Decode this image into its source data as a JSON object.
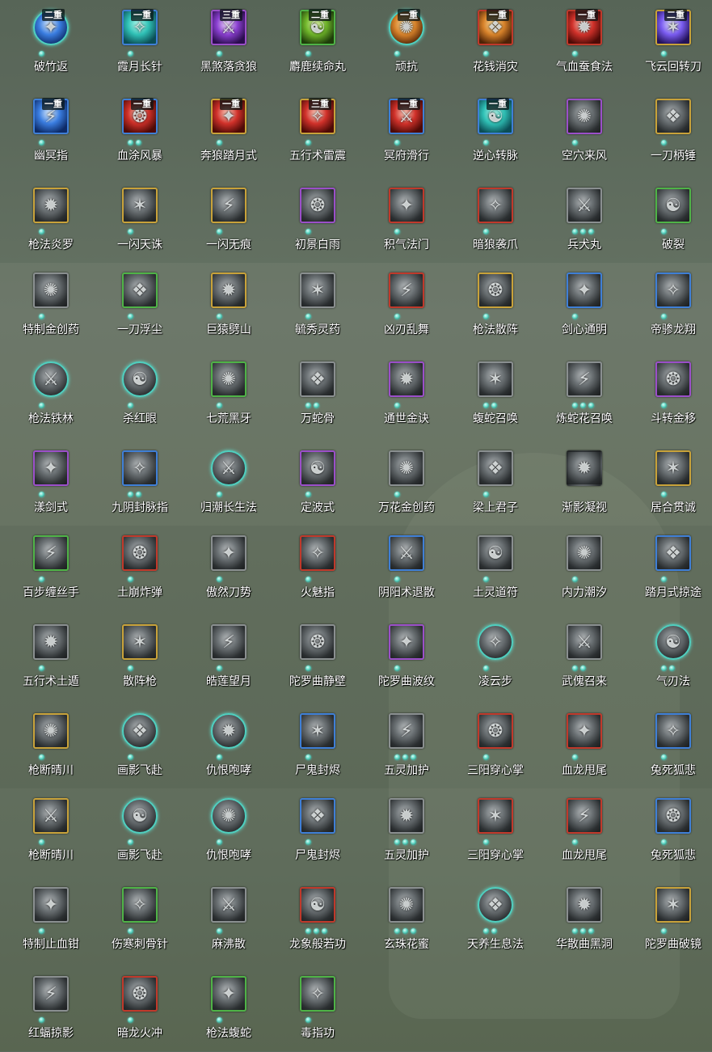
{
  "skills": [
    {
      "name": "破竹返",
      "badge": "二重",
      "dots": 1,
      "style": "circle",
      "color": "color-blue",
      "icon": "lightning-orb-icon"
    },
    {
      "name": "霞月长针",
      "badge": "一重",
      "dots": 1,
      "style": "cyan",
      "color": "color-cyan",
      "icon": "needle-icon"
    },
    {
      "name": "黑煞落贪狼",
      "badge": "三重",
      "dots": 1,
      "style": "purple",
      "color": "color-purple",
      "icon": "wolf-strike-icon"
    },
    {
      "name": "麝鹿续命丸",
      "badge": "二重",
      "dots": 1,
      "style": "green",
      "color": "color-green",
      "icon": "pill-icon"
    },
    {
      "name": "顽抗",
      "badge": "一重",
      "dots": 1,
      "style": "circle",
      "color": "color-orange",
      "icon": "flame-orb-icon"
    },
    {
      "name": "花钱消灾",
      "badge": "一重",
      "dots": 1,
      "style": "red",
      "color": "color-orange",
      "icon": "money-bag-icon"
    },
    {
      "name": "气血蚕食法",
      "badge": "一重",
      "dots": 1,
      "style": "red",
      "color": "color-red",
      "icon": "blood-burst-icon"
    },
    {
      "name": "飞云回转刀",
      "badge": "二重",
      "dots": 1,
      "style": "gold",
      "color": "color-violet",
      "icon": "flying-blade-icon"
    },
    {
      "name": "幽冥指",
      "badge": "一重",
      "dots": 1,
      "style": "blue",
      "color": "color-blue",
      "icon": "finger-strike-icon"
    },
    {
      "name": "血涂风暴",
      "badge": "一重",
      "dots": 2,
      "style": "blue",
      "color": "color-red",
      "icon": "blood-storm-icon"
    },
    {
      "name": "奔狼踏月式",
      "badge": "一重",
      "dots": 1,
      "style": "gold",
      "color": "color-red",
      "icon": "wolf-charge-icon"
    },
    {
      "name": "五行术雷震",
      "badge": "三重",
      "dots": 1,
      "style": "gold",
      "color": "color-red",
      "icon": "thunder-figure-icon"
    },
    {
      "name": "冥府滑行",
      "badge": "一重",
      "dots": 1,
      "style": "blue",
      "color": "color-red",
      "icon": "dash-icon"
    },
    {
      "name": "逆心转脉",
      "badge": "一重",
      "dots": 1,
      "style": "blue",
      "color": "color-cyan",
      "icon": "vortex-icon"
    },
    {
      "name": "空穴来风",
      "badge": "",
      "dots": 1,
      "style": "purple",
      "color": "",
      "icon": "coin-wind-icon"
    },
    {
      "name": "一刀柄锤",
      "badge": "",
      "dots": 1,
      "style": "gold",
      "color": "",
      "icon": "hammer-icon"
    },
    {
      "name": "枪法炎罗",
      "badge": "",
      "dots": 1,
      "style": "gold",
      "color": "",
      "icon": "spear-icon"
    },
    {
      "name": "一闪天诛",
      "badge": "",
      "dots": 1,
      "style": "gold",
      "color": "",
      "icon": "flash-strike-icon"
    },
    {
      "name": "一闪无痕",
      "badge": "",
      "dots": 1,
      "style": "gold",
      "color": "",
      "icon": "shadow-strike-icon"
    },
    {
      "name": "初景白雨",
      "badge": "",
      "dots": 1,
      "style": "purple",
      "color": "",
      "icon": "rain-icon"
    },
    {
      "name": "积气法门",
      "badge": "",
      "dots": 1,
      "style": "red",
      "color": "",
      "icon": "gather-qi-icon"
    },
    {
      "name": "暗狼袭爪",
      "badge": "",
      "dots": 1,
      "style": "red",
      "color": "",
      "icon": "claw-icon"
    },
    {
      "name": "兵犬丸",
      "badge": "",
      "dots": 3,
      "style": "grey",
      "color": "",
      "icon": "dog-pill-icon"
    },
    {
      "name": "破裂",
      "badge": "",
      "dots": 1,
      "style": "green",
      "color": "",
      "icon": "shatter-icon"
    },
    {
      "name": "特制金创药",
      "badge": "",
      "dots": 1,
      "style": "grey",
      "color": "",
      "icon": "medicine-icon"
    },
    {
      "name": "一刀浮尘",
      "badge": "",
      "dots": 1,
      "style": "green",
      "color": "",
      "icon": "sword-dust-icon"
    },
    {
      "name": "巨猿劈山",
      "badge": "",
      "dots": 1,
      "style": "gold",
      "color": "",
      "icon": "ape-icon"
    },
    {
      "name": "毓秀灵药",
      "badge": "",
      "dots": 1,
      "style": "grey",
      "color": "",
      "icon": "gourd-icon"
    },
    {
      "name": "凶刃乱舞",
      "badge": "",
      "dots": 1,
      "style": "red",
      "color": "",
      "icon": "blade-dance-icon"
    },
    {
      "name": "枪法散阵",
      "badge": "",
      "dots": 1,
      "style": "gold",
      "color": "",
      "icon": "spear-sweep-icon"
    },
    {
      "name": "剑心通明",
      "badge": "",
      "dots": 1,
      "style": "blue",
      "color": "",
      "icon": "sword-heart-icon"
    },
    {
      "name": "帝骖龙翔",
      "badge": "",
      "dots": 1,
      "style": "blue",
      "color": "",
      "icon": "dragon-icon"
    },
    {
      "name": "枪法铁林",
      "badge": "",
      "dots": 1,
      "style": "circle",
      "color": "",
      "icon": "iron-spear-icon"
    },
    {
      "name": "杀红眼",
      "badge": "",
      "dots": 1,
      "style": "circle",
      "color": "",
      "icon": "rage-icon"
    },
    {
      "name": "七荒黑牙",
      "badge": "",
      "dots": 1,
      "style": "green",
      "color": "",
      "icon": "fang-icon"
    },
    {
      "name": "万蛇骨",
      "badge": "",
      "dots": 2,
      "style": "grey",
      "color": "",
      "icon": "snake-bone-icon"
    },
    {
      "name": "通世金诀",
      "badge": "",
      "dots": 1,
      "style": "purple",
      "color": "",
      "icon": "golden-art-icon"
    },
    {
      "name": "蝮蛇召唤",
      "badge": "",
      "dots": 2,
      "style": "grey",
      "color": "",
      "icon": "viper-icon"
    },
    {
      "name": "炼蛇花召唤",
      "badge": "",
      "dots": 3,
      "style": "grey",
      "color": "",
      "icon": "serpent-flower-icon"
    },
    {
      "name": "斗转金移",
      "badge": "",
      "dots": 1,
      "style": "purple",
      "color": "",
      "icon": "reversal-icon"
    },
    {
      "name": "漾剑式",
      "badge": "",
      "dots": 1,
      "style": "purple",
      "color": "",
      "icon": "ripple-sword-icon"
    },
    {
      "name": "九阴封脉指",
      "badge": "",
      "dots": 2,
      "style": "blue",
      "color": "",
      "icon": "seal-finger-icon"
    },
    {
      "name": "归潮长生法",
      "badge": "",
      "dots": 1,
      "style": "circle",
      "color": "",
      "icon": "tide-icon"
    },
    {
      "name": "定波式",
      "badge": "",
      "dots": 1,
      "style": "purple",
      "color": "",
      "icon": "wave-calm-icon"
    },
    {
      "name": "万花金创药",
      "badge": "",
      "dots": 1,
      "style": "grey",
      "color": "",
      "icon": "flower-medicine-icon"
    },
    {
      "name": "梁上君子",
      "badge": "",
      "dots": 1,
      "style": "grey",
      "color": "",
      "icon": "thief-icon"
    },
    {
      "name": "渐影凝视",
      "badge": "",
      "dots": 0,
      "style": "none",
      "color": "",
      "icon": "shadow-gaze-icon"
    },
    {
      "name": "居合贯诚",
      "badge": "",
      "dots": 1,
      "style": "gold",
      "color": "",
      "icon": "iai-icon"
    },
    {
      "name": "百步缠丝手",
      "badge": "",
      "dots": 1,
      "style": "green",
      "color": "",
      "icon": "silk-hand-icon"
    },
    {
      "name": "土崩炸弹",
      "badge": "",
      "dots": 1,
      "style": "red",
      "color": "",
      "icon": "bomb-icon"
    },
    {
      "name": "傲然刀势",
      "badge": "",
      "dots": 1,
      "style": "grey",
      "color": "",
      "icon": "blade-stance-icon"
    },
    {
      "name": "火魅指",
      "badge": "",
      "dots": 1,
      "style": "red",
      "color": "",
      "icon": "fire-finger-icon"
    },
    {
      "name": "阴阳术退散",
      "badge": "",
      "dots": 1,
      "style": "blue",
      "color": "",
      "icon": "yin-yang-icon"
    },
    {
      "name": "土灵道符",
      "badge": "",
      "dots": 1,
      "style": "grey",
      "color": "",
      "icon": "talisman-icon"
    },
    {
      "name": "内力潮汐",
      "badge": "",
      "dots": 1,
      "style": "grey",
      "color": "",
      "icon": "inner-tide-icon"
    },
    {
      "name": "踏月式掠途",
      "badge": "",
      "dots": 1,
      "style": "blue",
      "color": "",
      "icon": "moon-step-icon"
    },
    {
      "name": "五行术土遁",
      "badge": "",
      "dots": 1,
      "style": "grey",
      "color": "",
      "icon": "earth-escape-icon"
    },
    {
      "name": "散阵枪",
      "badge": "",
      "dots": 1,
      "style": "gold",
      "color": "",
      "icon": "scatter-spear-icon"
    },
    {
      "name": "皓莲望月",
      "badge": "",
      "dots": 1,
      "style": "grey",
      "color": "",
      "icon": "crescent-icon"
    },
    {
      "name": "陀罗曲静壁",
      "badge": "",
      "dots": 1,
      "style": "grey",
      "color": "",
      "icon": "still-wall-icon"
    },
    {
      "name": "陀罗曲波纹",
      "badge": "",
      "dots": 1,
      "style": "purple",
      "color": "",
      "icon": "ripple-icon"
    },
    {
      "name": "凌云步",
      "badge": "",
      "dots": 1,
      "style": "circle",
      "color": "",
      "icon": "cloud-step-icon"
    },
    {
      "name": "武傀召来",
      "badge": "",
      "dots": 2,
      "style": "grey",
      "color": "",
      "icon": "puppet-icon"
    },
    {
      "name": "气刃法",
      "badge": "",
      "dots": 2,
      "style": "circle",
      "color": "",
      "icon": "qi-blade-icon"
    },
    {
      "name": "枪断晴川",
      "badge": "",
      "dots": 1,
      "style": "gold",
      "color": "",
      "icon": "spear-break-icon"
    },
    {
      "name": "画影飞赴",
      "badge": "",
      "dots": 1,
      "style": "circle",
      "color": "",
      "icon": "shadow-leap-icon"
    },
    {
      "name": "仇恨咆哮",
      "badge": "",
      "dots": 1,
      "style": "circle",
      "color": "",
      "icon": "roar-icon"
    },
    {
      "name": "尸鬼封烬",
      "badge": "",
      "dots": 1,
      "style": "blue",
      "color": "",
      "icon": "ghost-seal-icon"
    },
    {
      "name": "五灵加护",
      "badge": "",
      "dots": 3,
      "style": "grey",
      "color": "",
      "icon": "five-spirit-icon"
    },
    {
      "name": "三阳穿心掌",
      "badge": "",
      "dots": 1,
      "style": "red",
      "color": "",
      "icon": "palm-icon"
    },
    {
      "name": "血龙甩尾",
      "badge": "",
      "dots": 1,
      "style": "red",
      "color": "",
      "icon": "dragon-tail-icon"
    },
    {
      "name": "兔死狐悲",
      "badge": "",
      "dots": 1,
      "style": "blue",
      "color": "",
      "icon": "fox-icon"
    },
    {
      "name": "枪断晴川",
      "badge": "",
      "dots": 1,
      "style": "gold",
      "color": "",
      "icon": "spear-break-icon"
    },
    {
      "name": "画影飞赴",
      "badge": "",
      "dots": 1,
      "style": "circle",
      "color": "",
      "icon": "shadow-leap-icon"
    },
    {
      "name": "仇恨咆哮",
      "badge": "",
      "dots": 1,
      "style": "circle",
      "color": "",
      "icon": "roar-icon"
    },
    {
      "name": "尸鬼封烬",
      "badge": "",
      "dots": 1,
      "style": "blue",
      "color": "",
      "icon": "ghost-seal-icon"
    },
    {
      "name": "五灵加护",
      "badge": "",
      "dots": 3,
      "style": "grey",
      "color": "",
      "icon": "five-spirit-icon"
    },
    {
      "name": "三阳穿心掌",
      "badge": "",
      "dots": 1,
      "style": "red",
      "color": "",
      "icon": "palm-icon"
    },
    {
      "name": "血龙甩尾",
      "badge": "",
      "dots": 1,
      "style": "red",
      "color": "",
      "icon": "dragon-tail-icon"
    },
    {
      "name": "兔死狐悲",
      "badge": "",
      "dots": 1,
      "style": "blue",
      "color": "",
      "icon": "fox-icon"
    },
    {
      "name": "特制止血钳",
      "badge": "",
      "dots": 1,
      "style": "grey",
      "color": "",
      "icon": "clamp-icon"
    },
    {
      "name": "伤寒刺骨针",
      "badge": "",
      "dots": 1,
      "style": "green",
      "color": "",
      "icon": "bone-needle-icon"
    },
    {
      "name": "麻沸散",
      "badge": "",
      "dots": 1,
      "style": "grey",
      "color": "",
      "icon": "powder-icon"
    },
    {
      "name": "龙象般若功",
      "badge": "",
      "dots": 3,
      "style": "red",
      "color": "",
      "icon": "prajna-icon"
    },
    {
      "name": "玄珠花蜜",
      "badge": "",
      "dots": 3,
      "style": "grey",
      "color": "",
      "icon": "nectar-icon"
    },
    {
      "name": "天养生息法",
      "badge": "",
      "dots": 2,
      "style": "circle",
      "color": "",
      "icon": "meditation-icon"
    },
    {
      "name": "华散曲黑洞",
      "badge": "",
      "dots": 3,
      "style": "grey",
      "color": "",
      "icon": "black-hole-icon"
    },
    {
      "name": "陀罗曲破镜",
      "badge": "",
      "dots": 1,
      "style": "gold",
      "color": "",
      "icon": "broken-mirror-icon"
    },
    {
      "name": "红蝠掠影",
      "badge": "",
      "dots": 1,
      "style": "grey",
      "color": "",
      "icon": "bat-icon"
    },
    {
      "name": "暗龙火冲",
      "badge": "",
      "dots": 1,
      "style": "red",
      "color": "",
      "icon": "dark-dragon-icon"
    },
    {
      "name": "枪法蝮蛇",
      "badge": "",
      "dots": 1,
      "style": "green",
      "color": "",
      "icon": "spear-viper-icon"
    },
    {
      "name": "毒指功",
      "badge": "",
      "dots": 1,
      "style": "green",
      "color": "",
      "icon": "poison-finger-icon"
    }
  ]
}
